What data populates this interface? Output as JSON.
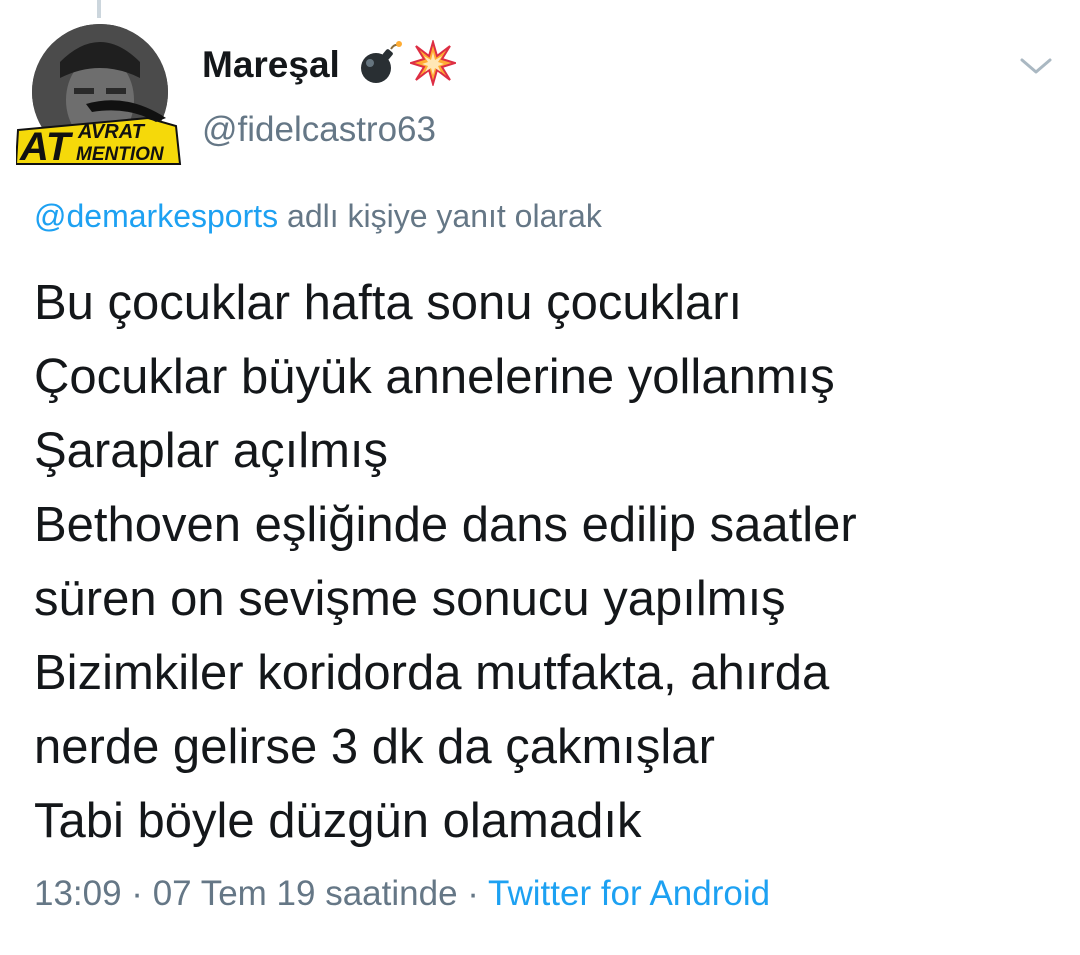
{
  "author": {
    "name": "Mareşal",
    "handle": "@fidelcastro63",
    "name_emojis": [
      "bomb-emoji",
      "collision-emoji"
    ],
    "avatar_badge_lines": [
      "AT",
      "AVRAT",
      "MENTION"
    ]
  },
  "reply": {
    "mention": "@demarkesports",
    "suffix": " adlı kişiye yanıt olarak"
  },
  "tweet": {
    "lines": [
      "Bu çocuklar hafta sonu çocukları",
      "Çocuklar büyük annelerine yollanmış",
      "Şaraplar açılmış",
      "Bethoven eşliğinde dans edilip saatler",
      "süren on sevişme sonucu yapılmış",
      "Bizimkiler koridorda mutfakta, ahırda",
      "nerde gelirse 3 dk da çakmışlar",
      "Tabi böyle düzgün olamadık"
    ]
  },
  "meta": {
    "timestamp": "13:09 · 07 Tem 19 saatinde",
    "separator": " · ",
    "source": "Twitter for Android"
  },
  "colors": {
    "text": "#14171a",
    "secondary": "#657786",
    "link": "#1da1f2",
    "badge_yellow": "#f5d90a"
  },
  "icons": {
    "menu": "chevron-down-icon"
  }
}
